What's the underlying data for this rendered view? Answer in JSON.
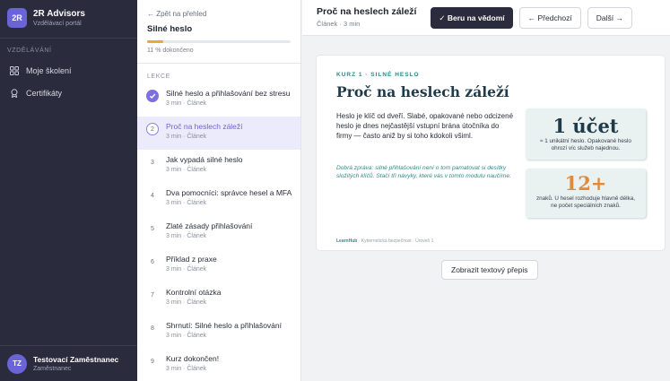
{
  "brand": {
    "badge": "2R",
    "name": "2R Advisors",
    "subtitle": "Vzdělávací portál"
  },
  "sidebar": {
    "section": "VZDĚLÁVÁNÍ",
    "items": [
      {
        "label": "Moje školení",
        "icon": "grid-icon"
      },
      {
        "label": "Certifikáty",
        "icon": "award-icon"
      }
    ]
  },
  "user": {
    "initials": "TZ",
    "name": "Testovací Zaměstnanec",
    "role": "Zaměstnanec"
  },
  "lesson_panel": {
    "back": "← Zpět na přehled",
    "course_title": "Silné heslo",
    "progress_percent": 11,
    "progress_text": "11 % dokončeno",
    "section": "LEKCE",
    "lessons": [
      {
        "num": "",
        "title": "Silné heslo a přihlašování bez stresu",
        "meta": "3 min · Článek",
        "state": "done"
      },
      {
        "num": "2",
        "title": "Proč na heslech záleží",
        "meta": "3 min · Článek",
        "state": "active"
      },
      {
        "num": "3",
        "title": "Jak vypadá silné heslo",
        "meta": "3 min · Článek",
        "state": ""
      },
      {
        "num": "4",
        "title": "Dva pomocníci: správce hesel a MFA",
        "meta": "3 min · Článek",
        "state": ""
      },
      {
        "num": "5",
        "title": "Zlaté zásady přihlašování",
        "meta": "3 min · Článek",
        "state": ""
      },
      {
        "num": "6",
        "title": "Příklad z praxe",
        "meta": "3 min · Článek",
        "state": ""
      },
      {
        "num": "7",
        "title": "Kontrolní otázka",
        "meta": "3 min · Článek",
        "state": ""
      },
      {
        "num": "8",
        "title": "Shrnutí: Silné heslo a přihlašování",
        "meta": "3 min · Článek",
        "state": ""
      },
      {
        "num": "9",
        "title": "Kurz dokončen!",
        "meta": "3 min · Článek",
        "state": ""
      }
    ]
  },
  "topbar": {
    "title": "Proč na heslech záleží",
    "subtitle": "Článek · 3 min",
    "ack_label": "✓ Beru na vědomí",
    "prev_label": "← Předchozí",
    "next_label": "Další →"
  },
  "slide": {
    "kicker": "KURZ 1 · SILNÉ HESLO",
    "title": "Proč na heslech záleží",
    "body": "Heslo je klíč od dveří. Slabé, opakované nebo odcizené heslo je dnes nejčastější vstupní brána útočníka do firmy — často aniž by si toho kdokoli všiml.",
    "note": "Dobrá zpráva: silné přihlašování není o tom pamatovat si desítky složitých klíčů. Stačí tři návyky, které vás v tomto modulu naučíme.",
    "stat1_value": "1 účet",
    "stat1_desc": "≈ 1 unikátní heslo. Opakované heslo ohrozí víc služeb najednou.",
    "stat2_value": "12+",
    "stat2_desc": "znaků. U hesel rozhoduje hlavně délka, ne počet speciálních znaků.",
    "footer_brand": "LearnHub",
    "footer_text": "· Kybernetická bezpečnost · Úroveň 1"
  },
  "transcript_label": "Zobrazit textový přepis",
  "colors": {
    "accent": "#6b63d8",
    "sidebar_bg": "#2a2b3d",
    "teal": "#2e8b87",
    "orange": "#e08a3a"
  }
}
